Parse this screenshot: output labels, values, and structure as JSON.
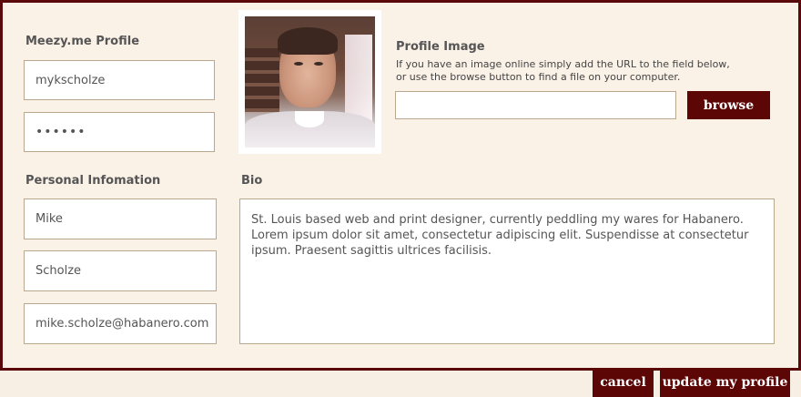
{
  "profile": {
    "heading": "Meezy.me Profile",
    "username": "mykscholze",
    "password": "••••••"
  },
  "personal": {
    "heading": "Personal Infomation",
    "first_name": "Mike",
    "last_name": "Scholze",
    "email": "mike.scholze@habanero.com"
  },
  "profile_image": {
    "heading": "Profile Image",
    "hint_line1": "If you have an image online simply add the URL to the field below,",
    "hint_line2": "or use the browse button to find a file on your computer.",
    "url_value": "",
    "browse_label": "browse"
  },
  "bio": {
    "heading": "Bio",
    "text": "St. Louis based web and print designer, currently peddling my wares for Habanero. Lorem ipsum dolor sit amet, consectetur adipiscing elit. Suspendisse at consectetur ipsum. Praesent sagittis ultrices facilisis."
  },
  "actions": {
    "cancel_label": "cancel",
    "update_label": "update my profile"
  },
  "colors": {
    "accent": "#5d0606",
    "panel_bg": "#faf1e7",
    "field_border": "#b9a88e"
  }
}
